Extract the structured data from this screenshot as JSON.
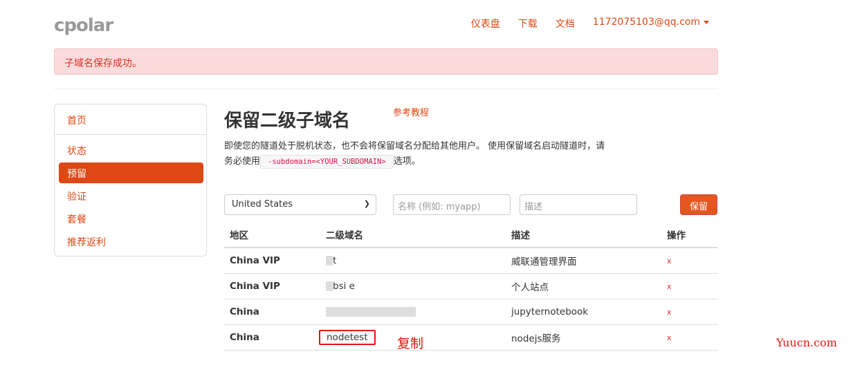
{
  "header": {
    "logo": "cpolar",
    "nav": [
      "仪表盘",
      "下载",
      "文档"
    ],
    "user": "1172075103@qq.com"
  },
  "alert": "子域名保存成功。",
  "sidebar": {
    "items": [
      {
        "label": "首页"
      },
      {
        "label": "状态"
      },
      {
        "label": "预留",
        "active": true
      },
      {
        "label": "验证"
      },
      {
        "label": "套餐"
      },
      {
        "label": "推荐返利"
      }
    ]
  },
  "main": {
    "title": "保留二级子域名",
    "tutorial_link": "参考教程",
    "desc_1": "即使您的隧道处于脱机状态，也不会将保留域名分配给其他用户。 使用保留域名启动隧道时，请务必使用",
    "desc_code": "-subdomain=<YOUR_SUBDOMAIN>",
    "desc_2": "选项。",
    "form": {
      "region": "United States",
      "name_placeholder": "名称 (例如: myapp)",
      "desc_placeholder": "描述",
      "submit": "保留"
    },
    "table": {
      "headers": [
        "地区",
        "二级域名",
        "描述",
        "操作"
      ],
      "rows": [
        {
          "region": "China VIP",
          "domain": "t",
          "desc": "威联通管理界面",
          "action": "x"
        },
        {
          "region": "China VIP",
          "domain": "bsi e",
          "desc": "个人站点",
          "action": "x"
        },
        {
          "region": "China",
          "domain": "",
          "desc": "jupyternotebook",
          "action": "x"
        },
        {
          "region": "China",
          "domain": "nodetest",
          "desc": "nodejs服务",
          "action": "x"
        }
      ]
    }
  },
  "annotation": "复制",
  "watermark": "Yuucn.com",
  "colors": {
    "accent": "#dd4814",
    "alert_bg": "#f9dcdb",
    "annotation": "#e8140f"
  }
}
